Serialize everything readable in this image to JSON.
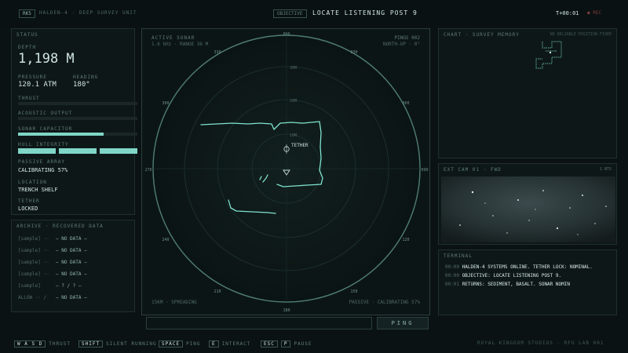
{
  "topbar": {
    "badge": "RK5",
    "vessel": "HALDEN-4 · DEEP SURVEY UNIT",
    "objective_label": "OBJECTIVE",
    "objective": "LOCATE LISTENING POST 9",
    "timer": "T+00:01",
    "rec": "● REC"
  },
  "status": {
    "title": "STATUS",
    "depth_label": "DEPTH",
    "depth": "1,198 M",
    "pressure_label": "PRESSURE",
    "pressure": "120.1 ATM",
    "heading_label": "HEADING",
    "heading": "180°",
    "thrust_label": "THRUST",
    "thrust": 0.0,
    "acoustic_label": "ACOUSTIC OUTPUT",
    "acoustic": 0.0,
    "sonar_label": "SONAR CAPACITOR",
    "sonar": 0.72,
    "hull_label": "HULL INTEGRITY",
    "hull_segments": 3,
    "passive_label": "PASSIVE ARRAY",
    "passive": "CALIBRATING 57%",
    "location_label": "LOCATION",
    "location": "TRENCH SHELF",
    "tether_label": "TETHER",
    "tether": "LOCKED"
  },
  "archive": {
    "title": "ARCHIVE · RECOVERED DATA",
    "rows": [
      {
        "k": "[sample] ··",
        "v": "— NO DATA —"
      },
      {
        "k": "[sample] ··",
        "v": "— NO DATA —"
      },
      {
        "k": "[sample] ··",
        "v": "— NO DATA —"
      },
      {
        "k": "[sample] ··",
        "v": "— NO DATA —"
      },
      {
        "k": "[sample]",
        "v": "— ? / ? —"
      },
      {
        "k": "ALLOW ·· /",
        "v": "— NO DATA —"
      }
    ]
  },
  "sonar": {
    "title": "ACTIVE SONAR",
    "sub": "1.6 kHz · RANGE 36 M",
    "pings_label": "PINGS 002",
    "north": "NORTH-UP · 0°",
    "tether_tag": "TETHER",
    "bottom_left": "15KM · SPREADING",
    "bottom_right": "PASSIVE · CALIBRATING 57%",
    "bearings": {
      "n": "000",
      "nne": "030",
      "ene": "060",
      "e": "090",
      "ese": "120",
      "sse": "150",
      "s": "180",
      "ssw": "210",
      "wsw": "240",
      "w": "270",
      "wnw": "300",
      "nnw": "330"
    },
    "ranges": {
      "r1": "10M",
      "r2": "20M",
      "r3": "30M"
    },
    "input_placeholder": "",
    "ping_label": "PING"
  },
  "chart": {
    "title": "CHART · SURVEY MEMORY",
    "hint": "NO RELIABLE POSITION FIXED"
  },
  "cam": {
    "title": "EXT CAM 01 · FWD",
    "tag": "1 NTS"
  },
  "terminal": {
    "title": "TERMINAL",
    "lines": [
      {
        "t": "00:00",
        "text": "HALDEN-4 SYSTEMS ONLINE. TETHER LOCK: NOMINAL."
      },
      {
        "t": "00:00",
        "text": "OBJECTIVE: LOCATE LISTENING POST 9."
      },
      {
        "t": "00:01",
        "text": "RETURNS: SEDIMENT, BASALT. SONAR NOMIN"
      }
    ]
  },
  "footer": {
    "keys_move": "W A S D",
    "move": "THRUST",
    "shift": "SHIFT",
    "silent": "SILENT RUNNING",
    "space": "SPACE",
    "ping": "PING",
    "e": "E",
    "interact": "INTERACT",
    "esc": "ESC",
    "p": "P",
    "pause": "PAUSE",
    "credit": "ROYAL KINGDOM STUDIOS · RFO LAB 001"
  }
}
